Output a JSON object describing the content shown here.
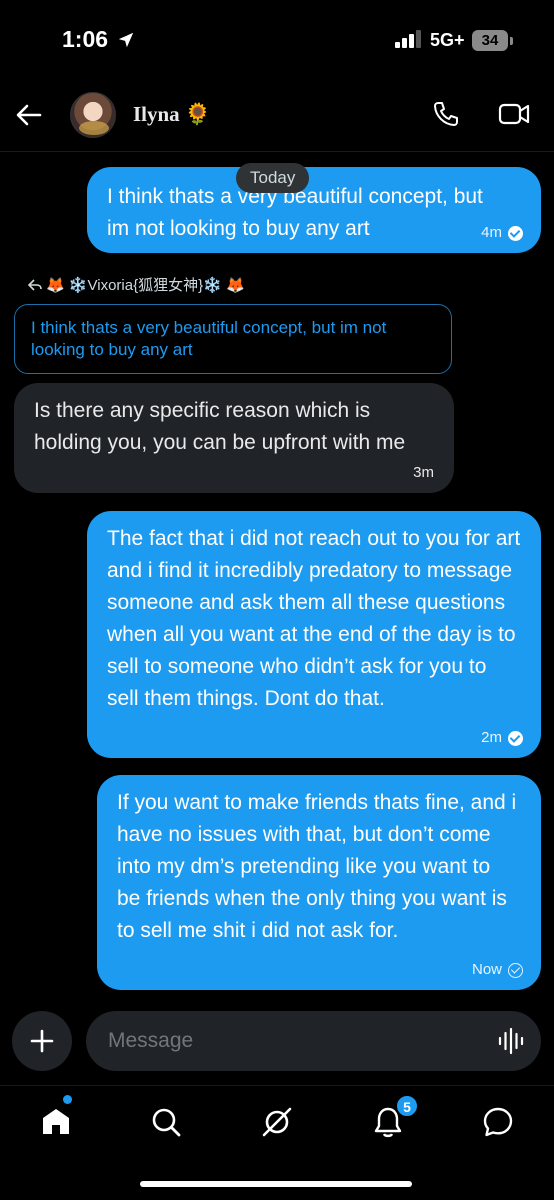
{
  "status_bar": {
    "time": "1:06",
    "network": "5G+",
    "battery": "34"
  },
  "header": {
    "contact_name": "Ilyna 🌻"
  },
  "messages": {
    "date_divider": "Today",
    "msg1": {
      "text": "I think thats a very beautiful concept, but im not looking to buy any art",
      "time": "4m",
      "status": "read"
    },
    "reply": {
      "label": "🦊 ❄️Vixoria{狐狸女神}❄️ 🦊",
      "quoted_text": "I think thats a very beautiful concept, but im not looking to buy any art"
    },
    "msg2": {
      "text": "Is there any specific reason which is holding you, you can be upfront with me",
      "time": "3m"
    },
    "msg3": {
      "text": "The fact that i did not reach out to you for art and i find it incredibly predatory to message someone and ask them all these questions when all you want at the end of the day is to sell to someone who didn’t ask for you to sell them things. Dont do that.",
      "time": "2m",
      "status": "read"
    },
    "msg4": {
      "text": "If you want to make friends thats fine, and i have no issues with that, but don’t come into my dm’s pretending like you want to be friends when the only thing you want is to sell me shit i did not ask for.",
      "time": "Now",
      "status": "sent"
    }
  },
  "composer": {
    "placeholder": "Message"
  },
  "nav": {
    "notifications_badge": "5"
  },
  "colors": {
    "accent": "#1d9bf0",
    "incoming_bubble": "#202327",
    "background": "#000000"
  }
}
